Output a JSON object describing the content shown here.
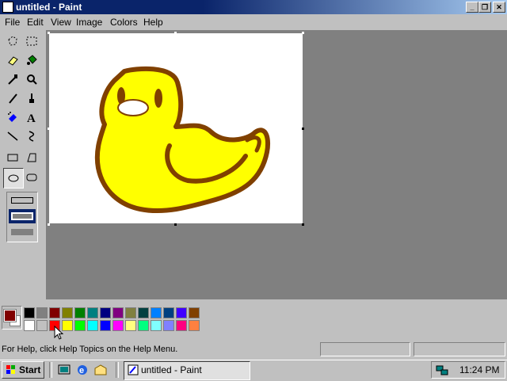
{
  "window": {
    "title": "untitled - Paint"
  },
  "menu": {
    "items": [
      "File",
      "Edit",
      "View",
      "Image",
      "Colors",
      "Help"
    ]
  },
  "toolbar": {
    "tools": [
      "free-select",
      "select",
      "eraser",
      "fill",
      "color-picker",
      "magnifier",
      "pencil",
      "brush",
      "airbrush",
      "text",
      "line",
      "curve",
      "rectangle",
      "polygon",
      "ellipse",
      "rounded-rectangle"
    ],
    "active_tool": "ellipse"
  },
  "colors": {
    "primary": "#800000",
    "secondary": "#ffffff",
    "palette": [
      "#000000",
      "#808080",
      "#800000",
      "#808000",
      "#008000",
      "#008080",
      "#000080",
      "#800080",
      "#808040",
      "#004040",
      "#0080ff",
      "#004080",
      "#4000ff",
      "#804000",
      "#ffffff",
      "#c0c0c0",
      "#ff0000",
      "#ffff00",
      "#00ff00",
      "#00ffff",
      "#0000ff",
      "#ff00ff",
      "#ffff80",
      "#00ff80",
      "#80ffff",
      "#8080ff",
      "#ff0080",
      "#ff8040"
    ]
  },
  "statusbar": {
    "help_text": "For Help, click Help Topics on the Help Menu."
  },
  "taskbar": {
    "start_label": "Start",
    "task_label": "untitled - Paint",
    "clock": "11:24 PM"
  }
}
